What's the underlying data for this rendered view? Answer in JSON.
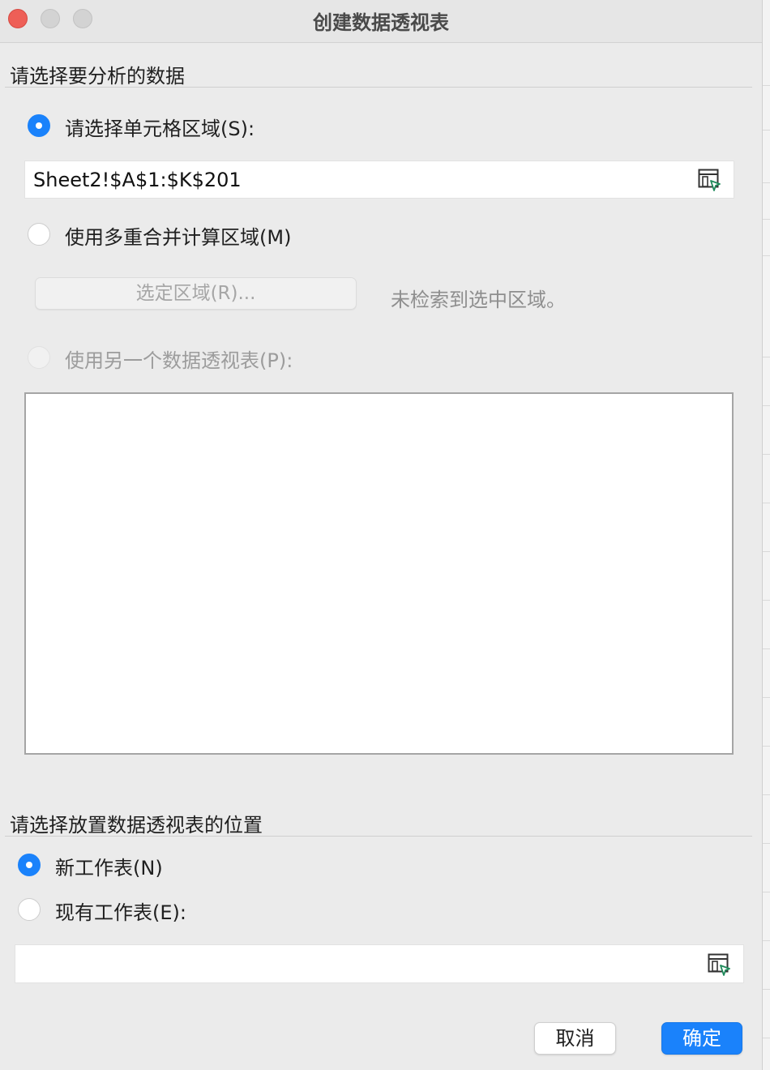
{
  "window": {
    "title": "创建数据透视表"
  },
  "source_section": {
    "heading": "请选择要分析的数据",
    "option_range_label": "请选择单元格区域(S):",
    "range_value": "Sheet2!$A$1:$K$201",
    "option_consolidate_label": "使用多重合并计算区域(M)",
    "select_range_button": "选定区域(R)...",
    "select_range_status": "未检索到选中区域。",
    "option_other_pivot_label": "使用另一个数据透视表(P):",
    "selected_option": "range"
  },
  "destination_section": {
    "heading": "请选择放置数据透视表的位置",
    "option_new_sheet_label": "新工作表(N)",
    "option_existing_sheet_label": "现有工作表(E):",
    "existing_sheet_value": "",
    "selected_option": "new_sheet"
  },
  "buttons": {
    "cancel": "取消",
    "ok": "确定"
  },
  "colors": {
    "accent": "#1a82fb",
    "close_light": "#ee5f57",
    "dialog_background": "#ebebeb",
    "range_icon_arrow": "#1e8a5a"
  }
}
